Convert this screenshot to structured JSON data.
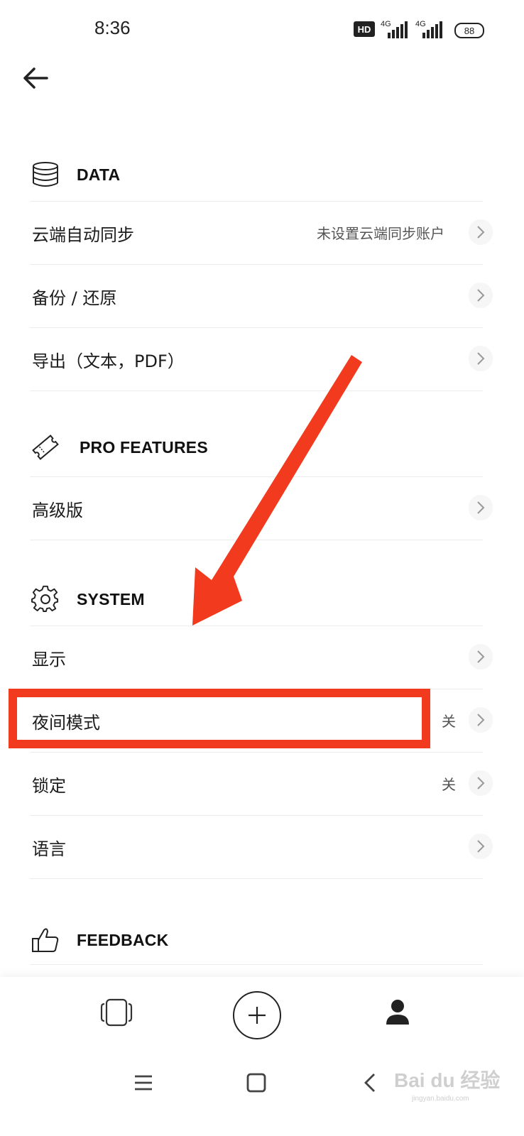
{
  "status_bar": {
    "time": "8:36",
    "hd_badge": "HD",
    "network_1": "4G",
    "network_2": "4G",
    "battery": "88"
  },
  "sections": {
    "data": {
      "title": "DATA",
      "icon": "database-icon",
      "items": [
        {
          "label": "云端自动同步",
          "value": "未设置云端同步账户"
        },
        {
          "label": "备份 / 还原",
          "value": ""
        },
        {
          "label": "导出（文本，PDF）",
          "value": ""
        }
      ]
    },
    "pro": {
      "title": "PRO FEATURES",
      "icon": "ticket-icon",
      "items": [
        {
          "label": "高级版",
          "value": ""
        }
      ]
    },
    "system": {
      "title": "SYSTEM",
      "icon": "gear-icon",
      "items": [
        {
          "label": "显示",
          "value": ""
        },
        {
          "label": "夜间模式",
          "value": "关"
        },
        {
          "label": "锁定",
          "value": "关"
        },
        {
          "label": "语言",
          "value": ""
        }
      ]
    },
    "feedback": {
      "title": "FEEDBACK",
      "icon": "thumbs-up-icon"
    }
  },
  "bottom_nav": {
    "items": [
      "cards-icon",
      "add-icon",
      "profile-icon"
    ]
  },
  "system_nav": {
    "items": [
      "menu-icon",
      "home-icon",
      "back-icon"
    ]
  },
  "annotation": {
    "color": "#f23a1e",
    "highlighted_item": "夜间模式"
  },
  "watermark": {
    "text": "Bai du 经验",
    "sub": "jingyan.baidu.com"
  }
}
